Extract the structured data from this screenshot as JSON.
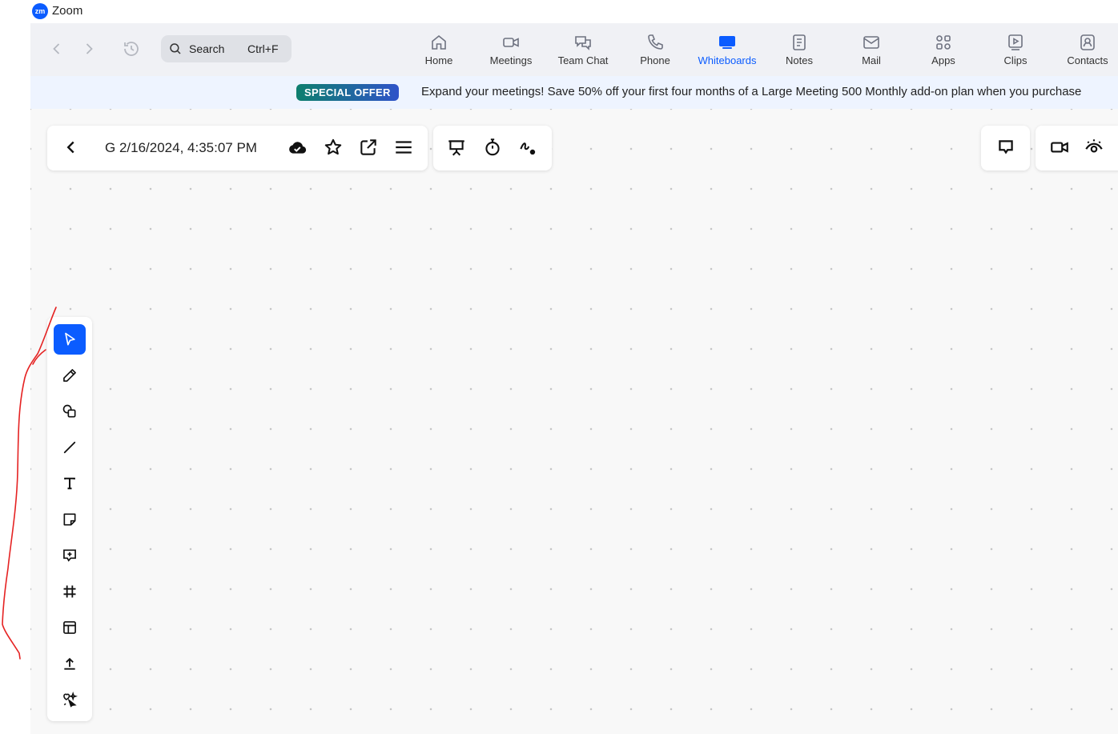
{
  "app": {
    "title": "Zoom",
    "logo_text": "zm"
  },
  "search": {
    "label": "Search",
    "shortcut": "Ctrl+F"
  },
  "tabs": [
    {
      "label": "Home",
      "icon": "home-icon"
    },
    {
      "label": "Meetings",
      "icon": "video-icon"
    },
    {
      "label": "Team Chat",
      "icon": "chat-icon"
    },
    {
      "label": "Phone",
      "icon": "phone-icon"
    },
    {
      "label": "Whiteboards",
      "icon": "whiteboard-icon",
      "active": true
    },
    {
      "label": "Notes",
      "icon": "notes-icon"
    },
    {
      "label": "Mail",
      "icon": "mail-icon"
    },
    {
      "label": "Apps",
      "icon": "apps-icon"
    },
    {
      "label": "Clips",
      "icon": "clips-icon"
    },
    {
      "label": "Contacts",
      "icon": "contacts-icon"
    }
  ],
  "banner": {
    "badge": "SPECIAL OFFER",
    "text": "Expand your meetings! Save 50% off your first four months of a Large Meeting 500 Monthly add-on plan when you purchase"
  },
  "whiteboard": {
    "title": "G 2/16/2024, 4:35:07 PM"
  },
  "tools": [
    "select",
    "pen",
    "shapes",
    "line",
    "text",
    "sticky-note",
    "comment",
    "frame",
    "templates",
    "upload",
    "ai-assist"
  ],
  "colors": {
    "accent": "#0b5cff",
    "annotation": "#e52222",
    "canvas": "#f8f8f8"
  }
}
